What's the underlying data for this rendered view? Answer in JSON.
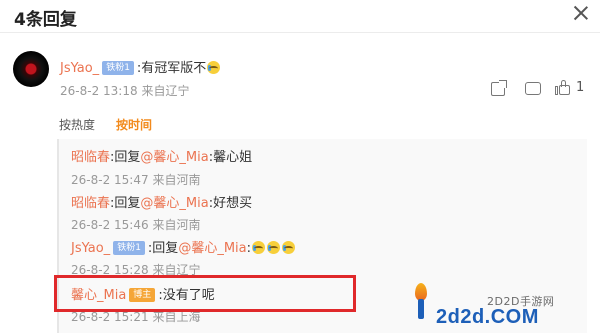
{
  "header": {
    "title": "4条回复"
  },
  "comment": {
    "user": "JsYao_",
    "badge": "铁粉1",
    "text": ":有冠军版不",
    "time": "26-8-2 13:18",
    "location": "来自辽宁",
    "likes": "1"
  },
  "sort": {
    "hot": "按热度",
    "time": "按时间"
  },
  "replies": [
    {
      "user": "昭临春",
      "reply_word": ":回复",
      "mention": "@馨心_Mia",
      "text": ":馨心姐",
      "time": "26-8-2 15:47",
      "location": "来自河南"
    },
    {
      "user": "昭临春",
      "reply_word": ":回复",
      "mention": "@馨心_Mia",
      "text": ":好想买",
      "time": "26-8-2 15:46",
      "location": "来自河南"
    },
    {
      "user": "JsYao_",
      "badge": "铁粉1",
      "reply_word": ":回复",
      "mention": "@馨心_Mia",
      "text": ":",
      "time": "26-8-2 15:28",
      "location": "来自辽宁"
    },
    {
      "user": "馨心_Mia",
      "badge": "博主",
      "text": ":没有了呢",
      "time": "26-8-2 15:21",
      "location": "来自上海"
    }
  ],
  "watermark": {
    "small": "2D2D手游网",
    "big": "2d2d.COM"
  },
  "colors": {
    "username": "#eb7350",
    "active_sort": "#f28a1c",
    "highlight": "#e0292b",
    "fan_badge": "#8fb3ea",
    "owner_badge": "#f5a637"
  }
}
